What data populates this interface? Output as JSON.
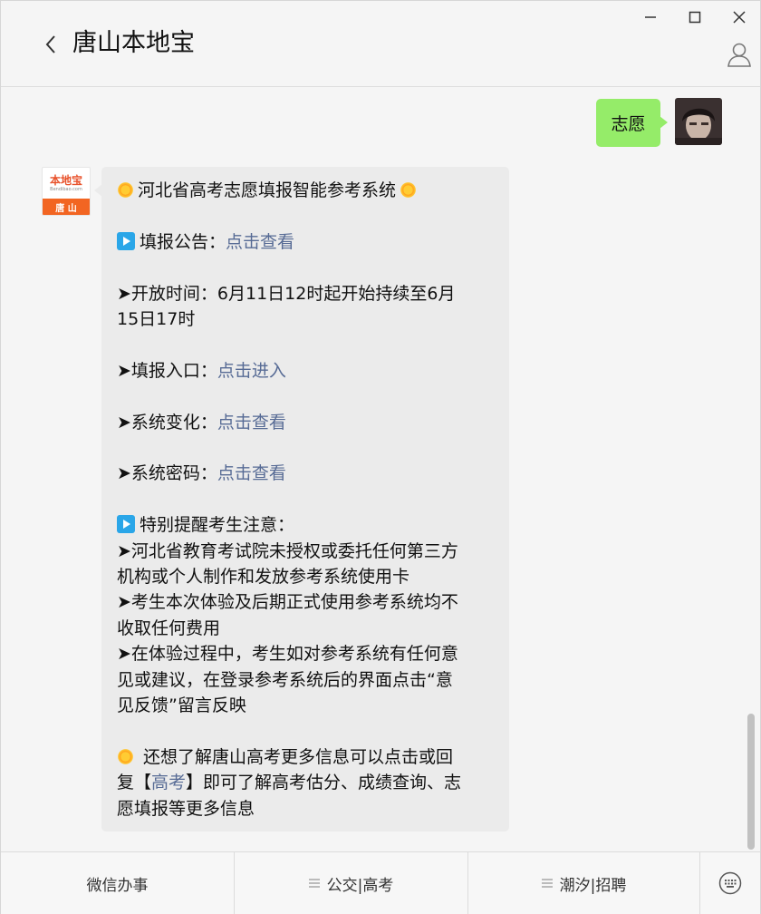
{
  "header": {
    "title": "唐山本地宝"
  },
  "messages": {
    "me": {
      "text": "志愿"
    },
    "bot": {
      "logo_top": "本地宝",
      "logo_sub": "Bendibao.com",
      "logo_city": "唐 山",
      "title": "河北省高考志愿填报智能参考系统",
      "notice_label": "填报公告：",
      "notice_link": "点击查看",
      "open_time_1": "➤开放时间：6月11日12时起开始持续至6月",
      "open_time_2": "15日17时",
      "entry_label": "➤填报入口：",
      "entry_link": "点击进入",
      "change_label": "➤系统变化：",
      "change_link": "点击查看",
      "password_label": "➤系统密码：",
      "password_link": "点击查看",
      "remind_title": "特别提醒考生注意：",
      "remind_1a": "➤河北省教育考试院未授权或委托任何第三方",
      "remind_1b": "机构或个人制作和发放参考系统使用卡",
      "remind_2a": "➤考生本次体验及后期正式使用参考系统均不",
      "remind_2b": "收取任何费用",
      "remind_3a": "➤在体验过程中，考生如对参考系统有任何意",
      "remind_3b": "见或建议，在登录参考系统后的界面点击“意",
      "remind_3c": "见反馈”留言反映",
      "more_1": " 还想了解唐山高考更多信息可以点击或回",
      "more_2a": "复【",
      "more_2_link": "高考",
      "more_2b": "】即可了解高考估分、成绩查询、志",
      "more_3": "愿填报等更多信息"
    }
  },
  "menu": [
    {
      "label": "微信办事",
      "has_icon": false
    },
    {
      "label": "公交|高考",
      "has_icon": true
    },
    {
      "label": "潮汐|招聘",
      "has_icon": true
    }
  ],
  "icons": {
    "back": "chevron-left-icon",
    "profile": "person-icon",
    "minimize": "minimize-icon",
    "maximize": "maximize-icon",
    "close": "close-icon",
    "keyboard": "keyboard-icon"
  }
}
